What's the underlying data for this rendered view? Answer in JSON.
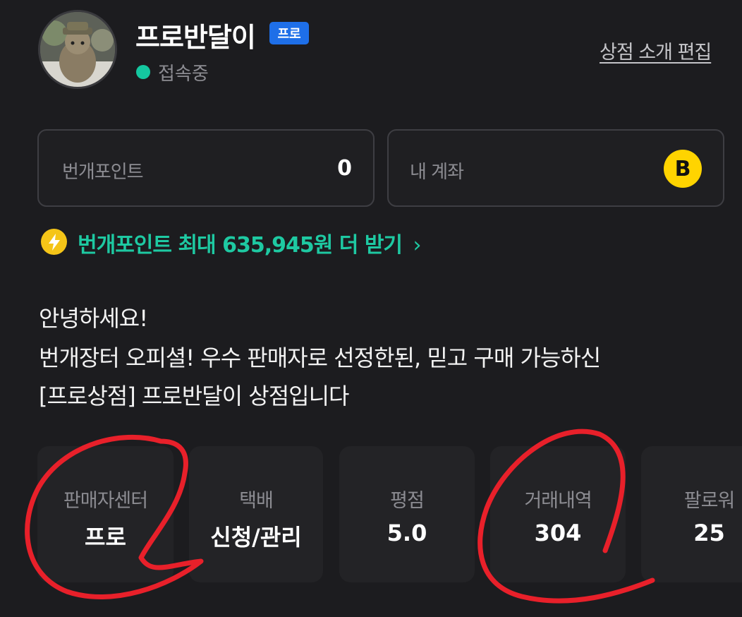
{
  "profile": {
    "shop_name": "프로반달이",
    "badge": "프로",
    "status": "접속중",
    "edit_link": "상점 소개 편집"
  },
  "cards": {
    "points_label": "번개포인트",
    "points_value": "0",
    "account_label": "내 계좌",
    "account_icon_letter": "B"
  },
  "promo": {
    "text": "번개포인트 최대 635,945원 더 받기",
    "chevron": "›"
  },
  "intro": {
    "lines": [
      "안녕하세요!",
      "번개장터 오피셜! 우수 판매자로 선정한된, 믿고 구매 가능하신",
      "[프로상점] 프로반달이 상점입니다"
    ]
  },
  "stats": [
    {
      "label": "판매자센터",
      "value": "프로"
    },
    {
      "label": "택배",
      "value": "신청/관리"
    },
    {
      "label": "평점",
      "value": "5.0"
    },
    {
      "label": "거래내역",
      "value": "304"
    },
    {
      "label": "팔로워",
      "value": "25"
    }
  ],
  "colors": {
    "background": "#1c1c1f",
    "accent_green": "#1ec9a2",
    "badge_blue": "#1e6fe8",
    "coin_yellow": "#ffd400",
    "annotation_red": "#e8202a"
  },
  "icons": [
    "avatar",
    "online-status-dot-icon",
    "b-coin-icon",
    "lightning-icon",
    "chevron-right-icon"
  ]
}
